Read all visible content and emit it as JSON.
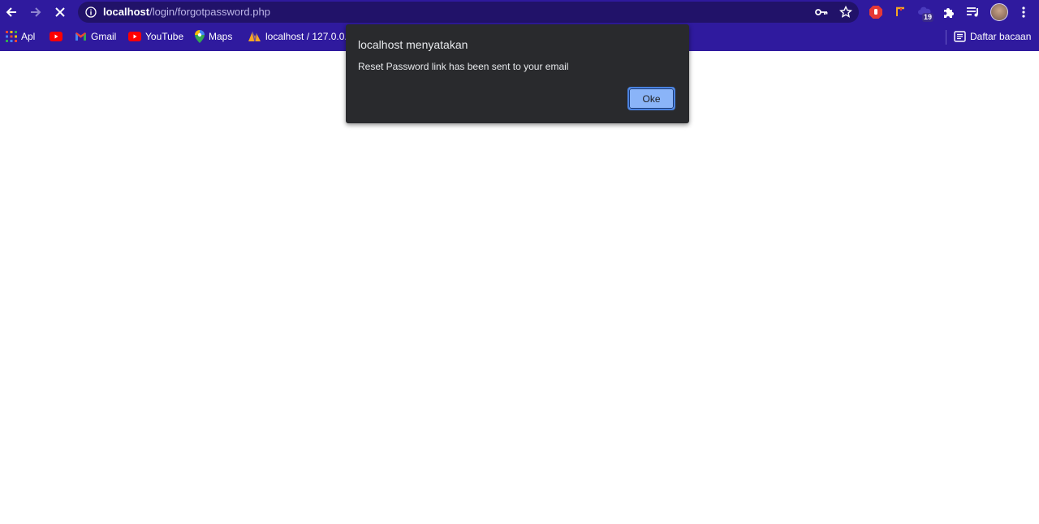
{
  "browser": {
    "url_host": "localhost",
    "url_path": "/login/forgotpassword.php",
    "extension_badge": "19"
  },
  "bookmarks": {
    "items": [
      {
        "label": "Apl",
        "icon": "apps-grid-icon"
      },
      {
        "label": "",
        "icon": "youtube-icon"
      },
      {
        "label": "Gmail",
        "icon": "gmail-icon"
      },
      {
        "label": "YouTube",
        "icon": "youtube-icon"
      },
      {
        "label": "Maps",
        "icon": "maps-pin-icon"
      },
      {
        "label": "localhost / 127.0.0...",
        "icon": "phpmyadmin-icon"
      }
    ],
    "reading_list": "Daftar bacaan"
  },
  "dialog": {
    "title": "localhost menyatakan",
    "message": "Reset Password link has been sent to your email",
    "ok_label": "Oke"
  },
  "colors": {
    "chrome_bg": "#2f1a9e",
    "omnibox_bg": "#211269",
    "dialog_bg": "#292a2d",
    "button_bg": "#8ab4f8"
  }
}
